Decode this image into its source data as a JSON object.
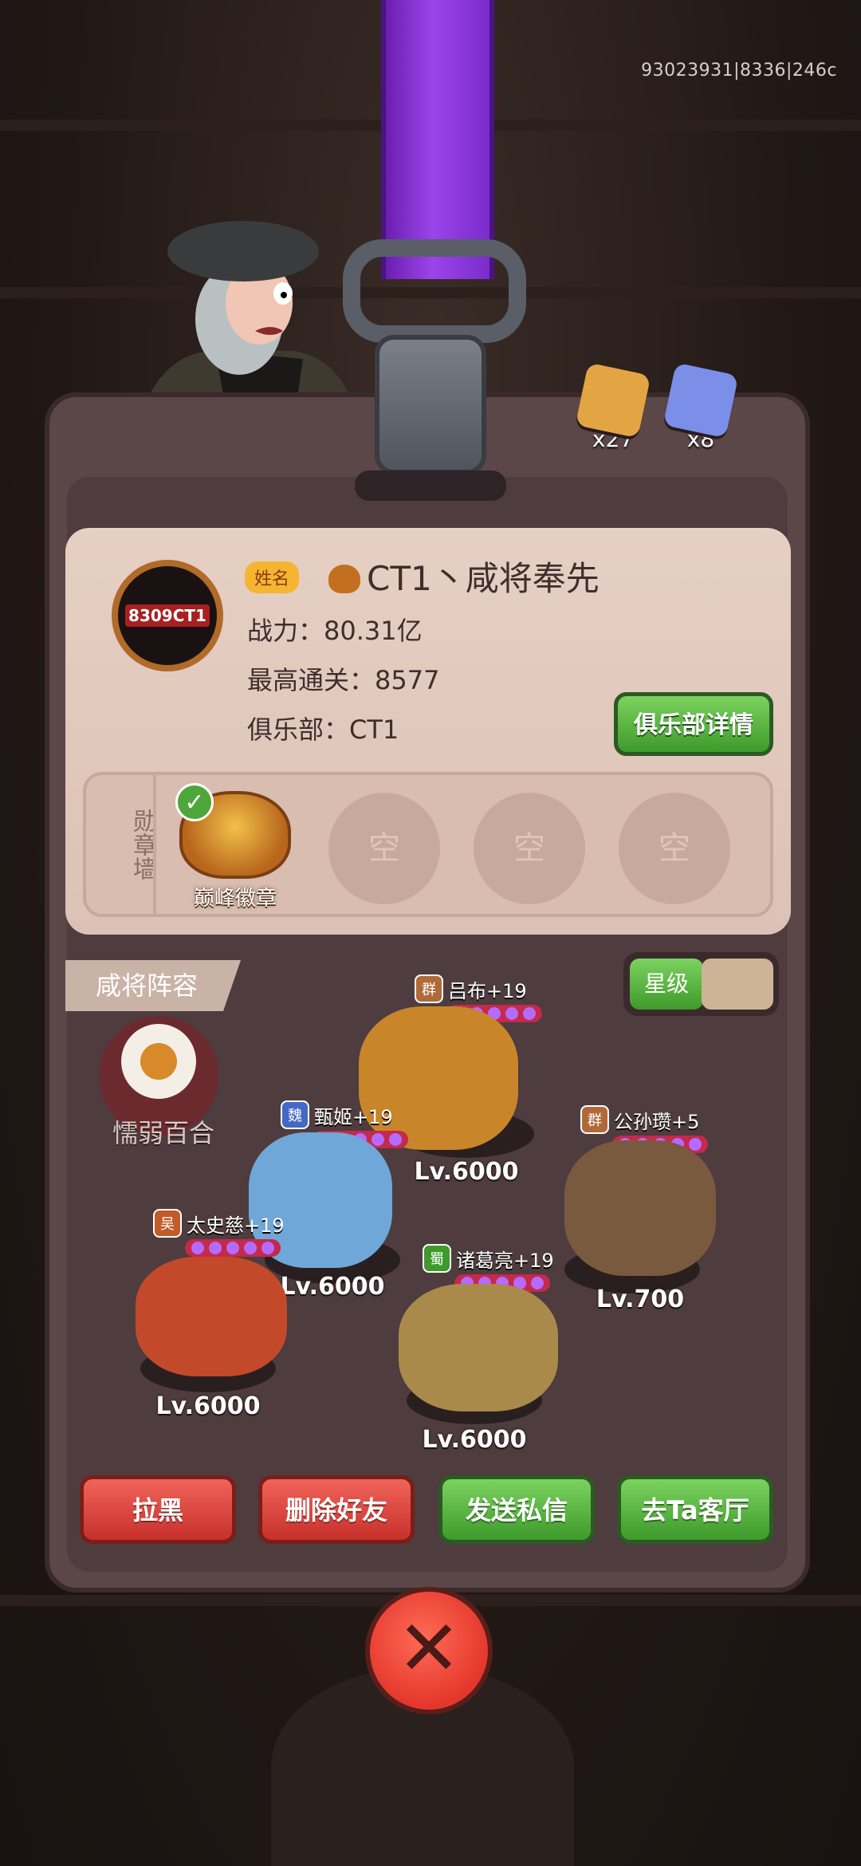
{
  "build_id": "93023931|8336|246c",
  "currencies": [
    {
      "name": "gold-card",
      "count": "x27",
      "color": "#e3a544"
    },
    {
      "name": "blue-card",
      "count": "x8",
      "color": "#7b8ee8"
    }
  ],
  "profile": {
    "avatar_text": "8309CT1",
    "name_tag": "姓名",
    "name": "CT1丶咸将奉先",
    "power": "战力：80.31亿",
    "max_clear": "最高通关：8577",
    "club": "俱乐部：CT1",
    "club_button": "俱乐部详情"
  },
  "medal_wall": {
    "label": "勋章墙",
    "medal_name": "巅峰徽章",
    "empty_label": "空"
  },
  "lineup": {
    "tab_label": "咸将阵容",
    "toggle_label": "星级",
    "pet_name": "懦弱百合",
    "heroes": [
      {
        "faction": "群",
        "faction_color": "#b06a3a",
        "name": "吕布+19",
        "level": "Lv.6000",
        "color": "#c9852a"
      },
      {
        "faction": "魏",
        "faction_color": "#4468c4",
        "name": "甄姬+19",
        "level": "Lv.6000",
        "color": "#6fa7d8"
      },
      {
        "faction": "群",
        "faction_color": "#b06a3a",
        "name": "公孙瓒+5",
        "level": "Lv.700",
        "color": "#7a5a3e"
      },
      {
        "faction": "吴",
        "faction_color": "#c25a2a",
        "name": "太史慈+19",
        "level": "Lv.6000",
        "color": "#c24a2a"
      },
      {
        "faction": "蜀",
        "faction_color": "#3e9a2b",
        "name": "诸葛亮+19",
        "level": "Lv.6000",
        "color": "#a98a4a"
      }
    ]
  },
  "actions": {
    "block": "拉黑",
    "delete_friend": "删除好友",
    "send_message": "发送私信",
    "visit_lounge": "去Ta客厅"
  }
}
